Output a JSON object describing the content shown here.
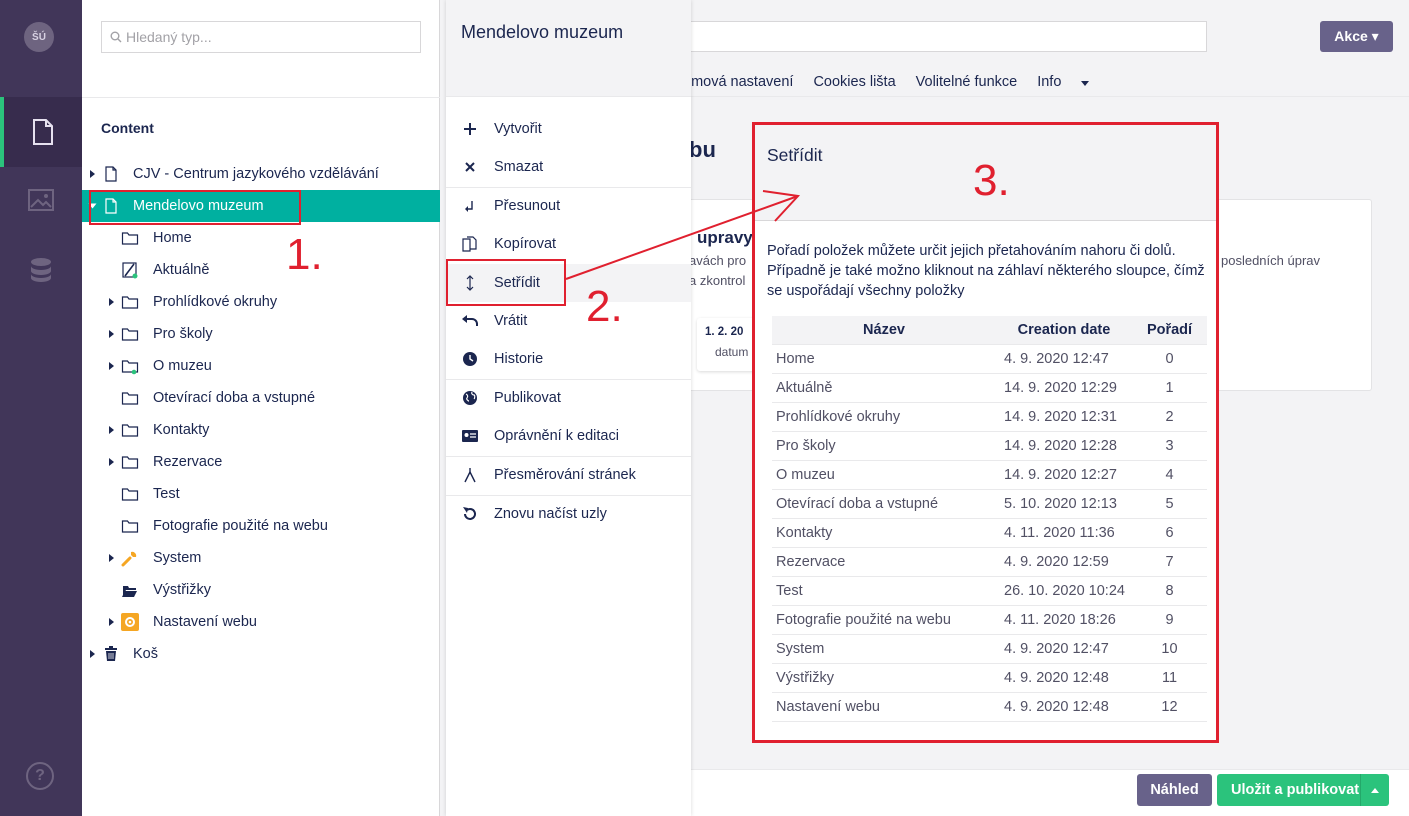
{
  "appbar": {
    "avatar_initials": "ŠÚ",
    "sections": [
      "content-icon",
      "media-icon",
      "settings-icon"
    ],
    "help_label": "?"
  },
  "tree": {
    "search_placeholder": "Hledaný typ...",
    "root_label": "Content",
    "nodes": [
      {
        "label": "CJV - Centrum jazykového vzdělávání",
        "icon": "document-icon"
      },
      {
        "label": "Mendelovo muzeum",
        "icon": "document-icon"
      },
      {
        "label": "Home",
        "icon": "folder-icon"
      },
      {
        "label": "Aktuálně",
        "icon": "news-icon"
      },
      {
        "label": "Prohlídkové okruhy",
        "icon": "folder-icon"
      },
      {
        "label": "Pro školy",
        "icon": "folder-icon"
      },
      {
        "label": "O muzeu",
        "icon": "folder-icon"
      },
      {
        "label": "Otevírací doba a vstupné",
        "icon": "folder-icon"
      },
      {
        "label": "Kontakty",
        "icon": "folder-icon"
      },
      {
        "label": "Rezervace",
        "icon": "folder-icon"
      },
      {
        "label": "Test",
        "icon": "folder-icon"
      },
      {
        "label": "Fotografie použité na webu",
        "icon": "folder-icon"
      },
      {
        "label": "System",
        "icon": "wrench-icon"
      },
      {
        "label": "Výstřižky",
        "icon": "open-folder-icon"
      },
      {
        "label": "Nastavení webu",
        "icon": "gear-icon"
      },
      {
        "label": "Koš",
        "icon": "trash-icon"
      }
    ]
  },
  "actions": {
    "title": "Mendelovo muzeum",
    "items": [
      {
        "label": "Vytvořit",
        "icon": "plus-icon"
      },
      {
        "label": "Smazat",
        "icon": "close-icon"
      },
      {
        "label": "Přesunout",
        "icon": "move-icon"
      },
      {
        "label": "Kopírovat",
        "icon": "copy-icon"
      },
      {
        "label": "Setřídit",
        "icon": "sort-icon"
      },
      {
        "label": "Vrátit",
        "icon": "undo-icon"
      },
      {
        "label": "Historie",
        "icon": "history-icon"
      },
      {
        "label": "Publikovat",
        "icon": "globe-icon"
      },
      {
        "label": "Oprávnění k editaci",
        "icon": "permissions-icon"
      },
      {
        "label": "Přesměrování stránek",
        "icon": "redirect-icon"
      },
      {
        "label": "Znovu načíst uzly",
        "icon": "reload-icon"
      }
    ]
  },
  "main": {
    "akce_label": "Akce ▾",
    "tabs": [
      "émová nastavení",
      "Cookies lišta",
      "Volitelné funkce",
      "Info"
    ],
    "heading": "bu",
    "card_title": "upravy",
    "card_text_1": "avách pro",
    "card_text_2": "a zkontrol",
    "card_text_3": "posledních úprav",
    "mini_date": "1. 2. 20",
    "mini_text": "datum",
    "preview_label": "Náhled",
    "save_publish_label": "Uložit a publikovat"
  },
  "dialog": {
    "title": "Setřídit",
    "description": "Pořadí položek můžete určit jejich přetahováním nahoru či dolů. Případně je také možno kliknout na záhlaví některého sloupce, čímž se uspořádají všechny položky",
    "columns": [
      "Název",
      "Creation date",
      "Pořadí"
    ],
    "rows": [
      [
        "Home",
        "4. 9. 2020 12:47",
        "0"
      ],
      [
        "Aktuálně",
        "14. 9. 2020 12:29",
        "1"
      ],
      [
        "Prohlídkové okruhy",
        "14. 9. 2020 12:31",
        "2"
      ],
      [
        "Pro školy",
        "14. 9. 2020 12:28",
        "3"
      ],
      [
        "O muzeu",
        "14. 9. 2020 12:27",
        "4"
      ],
      [
        "Otevírací doba a vstupné",
        "5. 10. 2020 12:13",
        "5"
      ],
      [
        "Kontakty",
        "4. 11. 2020 11:36",
        "6"
      ],
      [
        "Rezervace",
        "4. 9. 2020 12:59",
        "7"
      ],
      [
        "Test",
        "26. 10. 2020 10:24",
        "8"
      ],
      [
        "Fotografie použité na webu",
        "4. 11. 2020 18:26",
        "9"
      ],
      [
        "System",
        "4. 9. 2020 12:47",
        "10"
      ],
      [
        "Výstřižky",
        "4. 9. 2020 12:48",
        "11"
      ],
      [
        "Nastavení webu",
        "4. 9. 2020 12:48",
        "12"
      ]
    ]
  },
  "annotations": {
    "step1": "1.",
    "step2": "2.",
    "step3": "3.",
    "color": "#e0202f"
  },
  "colors": {
    "appbar": "#413659",
    "selected": "#00b0a0",
    "primary_button": "#2bc37c",
    "secondary_button": "#68628a"
  }
}
